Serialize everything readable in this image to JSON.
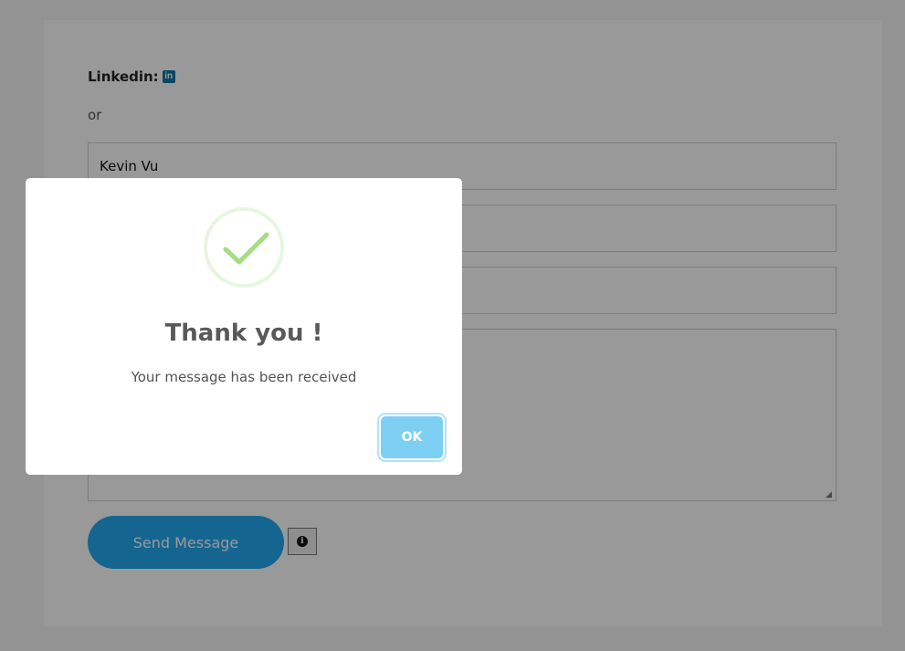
{
  "contact": {
    "linkedin_label": "Linkedin:",
    "linkedin_icon": "linkedin-icon",
    "linkedin_glyph": "in",
    "or_text": "or",
    "name_value": "Kevin Vu",
    "send_label": "Send Message",
    "info_icon": "info-icon",
    "info_glyph": "i"
  },
  "modal": {
    "icon": "check-icon",
    "title": "Thank you !",
    "message": "Your message has been received",
    "ok_label": "OK"
  },
  "colors": {
    "send_button": "#22aaf0",
    "ok_button": "#7ecff4",
    "check": "#a5dc86",
    "linkedin": "#0e76a8"
  }
}
